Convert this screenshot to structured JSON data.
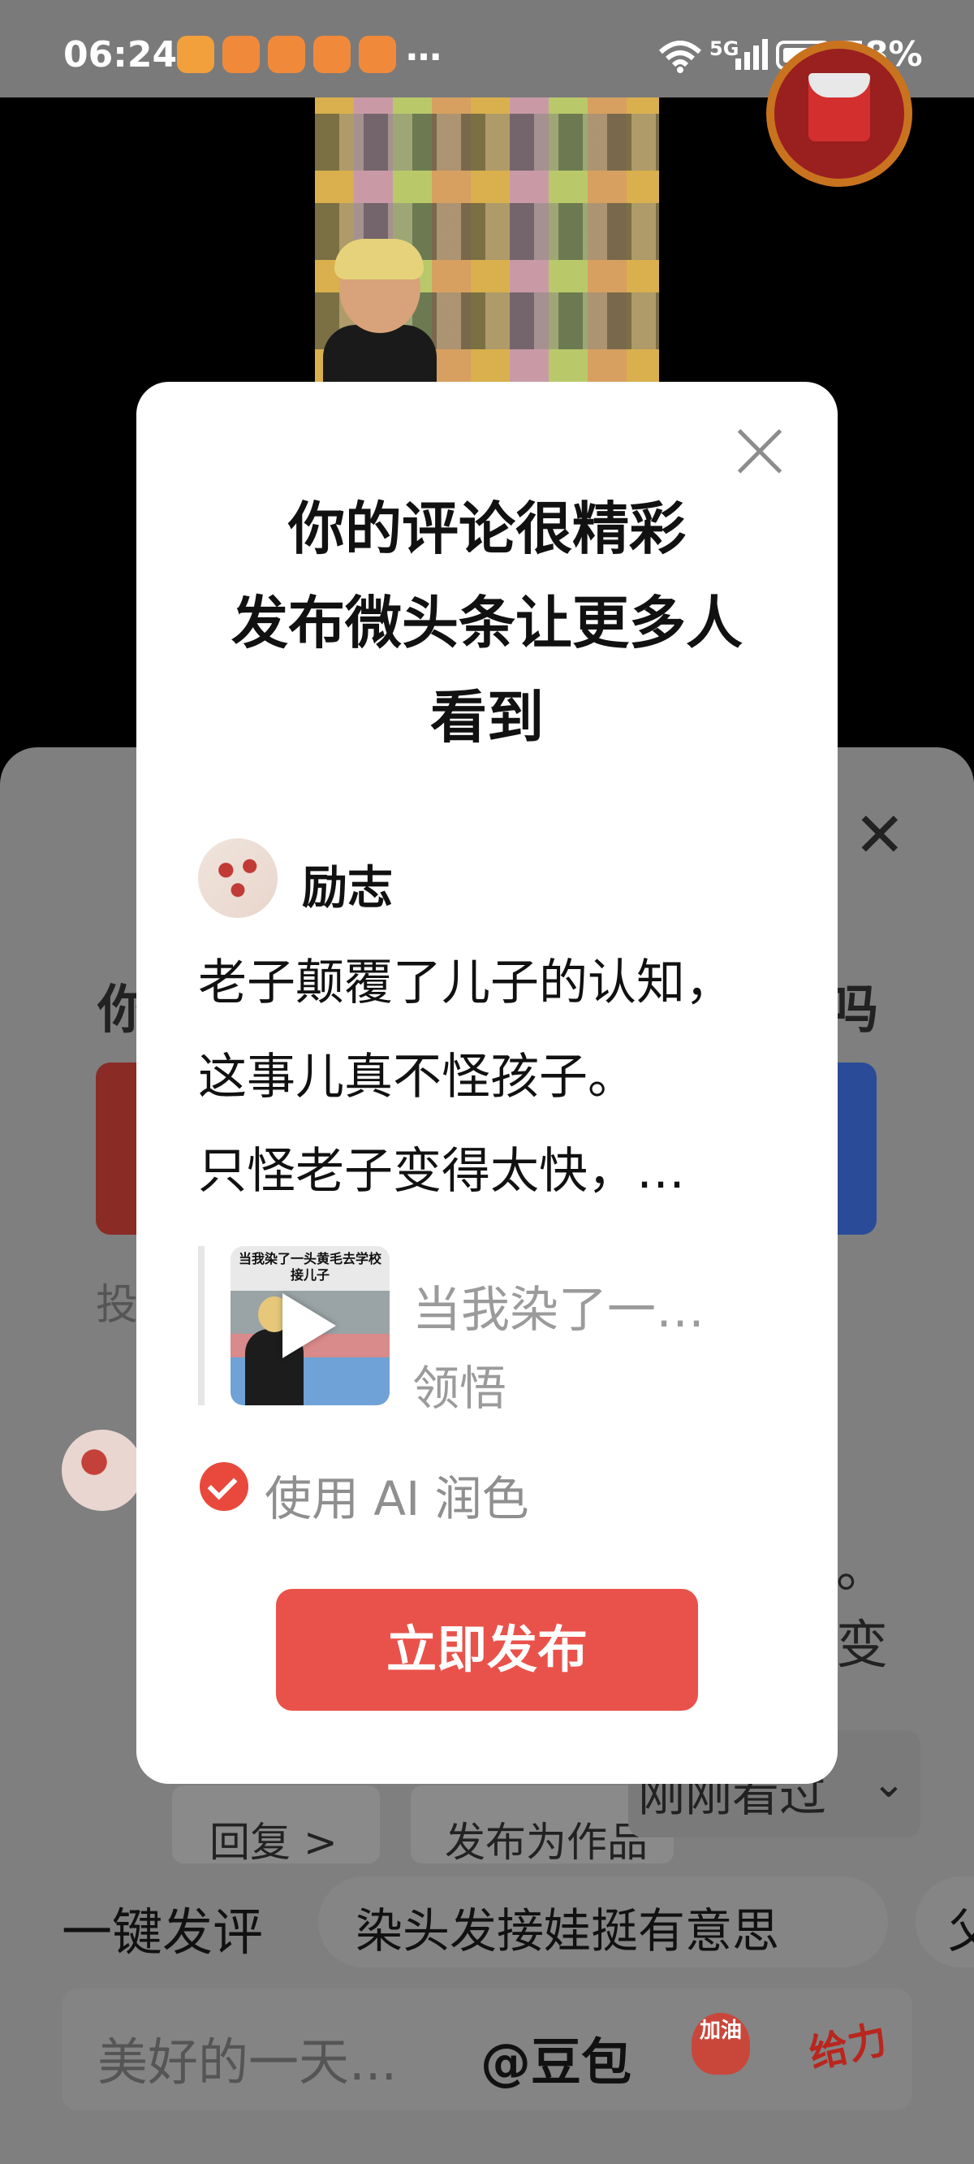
{
  "status_bar": {
    "time": "06:24",
    "more_indicator": "…",
    "network": "5G",
    "battery_percent": "78%",
    "battery_level": 0.78
  },
  "modal": {
    "title_lines": [
      "你的评论很精彩",
      "发布微头条让更多人",
      "看到"
    ],
    "author_name": "励志",
    "body_lines": [
      "老子颠覆了儿子的认知，",
      "这事儿真不怪孩子。",
      "只怪老子变得太快，…"
    ],
    "reference": {
      "thumbnail_caption": "当我染了一头黄毛去学校接儿子",
      "title": "当我染了一…",
      "author": "领悟"
    },
    "ai_polish_label": "使用 AI 润色",
    "ai_polish_checked": true,
    "publish_button": "立即发布"
  },
  "background": {
    "partial_title_left": "你",
    "partial_title_right": "吗",
    "partial_left_label": "投",
    "partial_comment_right_1": "。",
    "partial_comment_right_2": "变",
    "recently_viewed": "刚刚看过",
    "reply_button": "回复 >",
    "publish_as_post": "发布为作品",
    "one_click_comment": "一键发评",
    "suggested_comment": "染头发接娃挺有意思",
    "suggested_comment_2": "父",
    "input_placeholder": "美好的一天...",
    "at_mention": "@豆包",
    "sticker_jiayou": "加油",
    "sticker_geili": "给力"
  },
  "colors": {
    "accent_red": "#e9524a",
    "check_red": "#e8493c",
    "overlay_gray": "#7f7f7f"
  }
}
